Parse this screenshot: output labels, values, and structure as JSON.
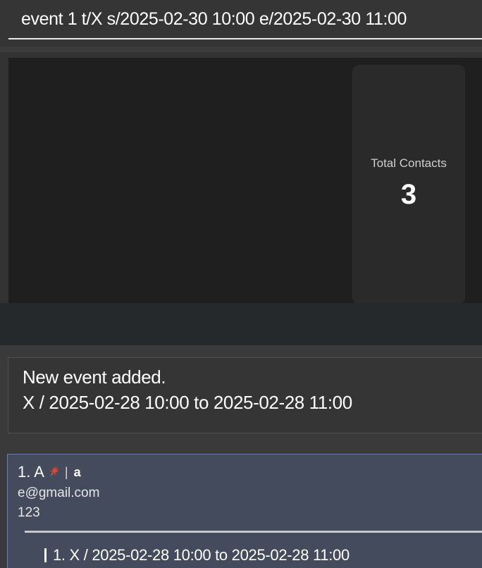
{
  "command_box": {
    "value": "event 1 t/X s/2025-02-30 10:00 e/2025-02-30 11:00"
  },
  "dashboard": {
    "stat_label": "Total Contacts",
    "stat_value": "3"
  },
  "result_display": {
    "line1": "New event added.",
    "line2": "X / 2025-02-28 10:00 to 2025-02-28 11:00"
  },
  "person_list": [
    {
      "index_name": "1. A",
      "pinned_icon": "pin-icon",
      "separator": "|",
      "tag": "a",
      "email": "e@gmail.com",
      "phone": "123",
      "events": [
        {
          "text": "1. X / 2025-02-28 10:00 to 2025-02-28 11:00"
        }
      ]
    }
  ],
  "colors": {
    "background": "#3c3c3c",
    "dashboard_panel": "#1f1f1f",
    "stat_card": "#2a2a2a",
    "person_card": "#434b5c",
    "person_card_border": "#6a7fa0",
    "pin": "#c0392b"
  }
}
